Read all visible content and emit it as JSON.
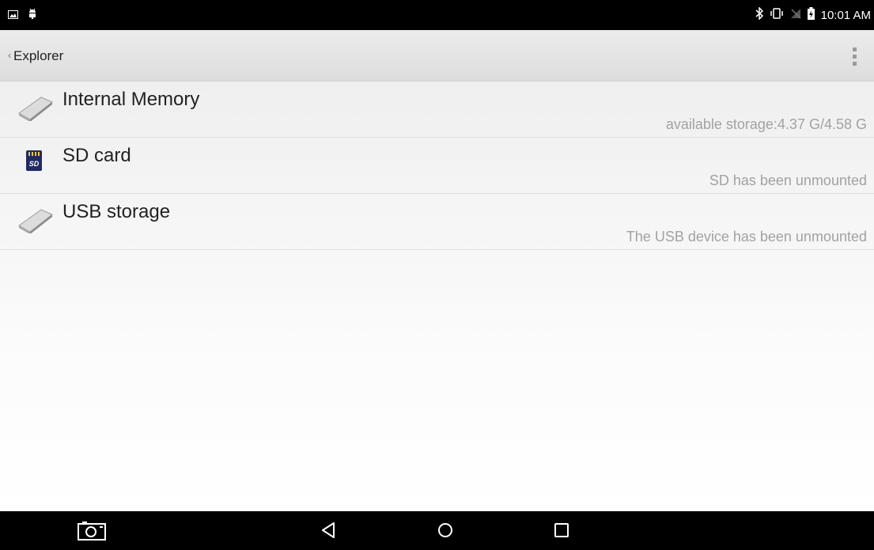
{
  "status_bar": {
    "time": "10:01 AM",
    "left_icons": [
      "gallery-notification-icon",
      "android-debug-icon"
    ],
    "right_icons": [
      "bluetooth-icon",
      "vibrate-icon",
      "no-signal-icon",
      "battery-charging-icon"
    ]
  },
  "action_bar": {
    "back_glyph": "‹",
    "title": "Explorer",
    "overflow_icon": "overflow-menu-icon"
  },
  "storage_list": [
    {
      "label": "Internal Memory",
      "detail": "available storage:4.37 G/4.58 G",
      "icon": "drive-icon"
    },
    {
      "label": "SD card",
      "detail": "SD has been unmounted",
      "icon": "sd-card-icon",
      "icon_text": "SD"
    },
    {
      "label": "USB storage",
      "detail": "The USB device has been unmounted",
      "icon": "drive-icon"
    }
  ],
  "nav_bar": {
    "buttons": [
      "screenshot-icon",
      "back-icon",
      "home-icon",
      "recents-icon"
    ]
  },
  "colors": {
    "status_bar_bg": "#000000",
    "action_bar_bg": "#e4e4e4",
    "primary_text": "#222222",
    "secondary_text": "#a2a2a2"
  }
}
